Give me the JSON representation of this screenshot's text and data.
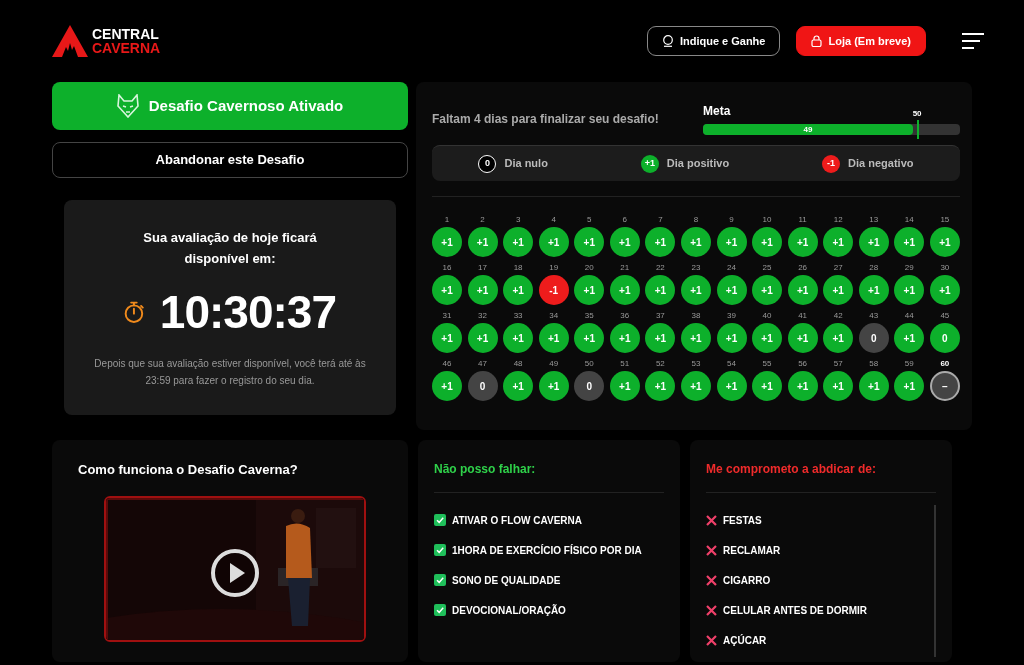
{
  "header": {
    "logo": {
      "line1": "CENTRAL",
      "line2": "CAVERNA"
    },
    "buttons": [
      {
        "kind": "outline",
        "label": "Indique e Ganhe"
      },
      {
        "kind": "solid",
        "label": "Loja (Em breve)"
      }
    ]
  },
  "challenge": {
    "active_button": "Desafio Cavernoso Ativado",
    "abandon_button": "Abandonar este Desafio"
  },
  "timer_card": {
    "title": "Sua avaliação de hoje ficará disponível em:",
    "time": "10:30:37",
    "note": "Depois que sua avaliação estiver disponível, você terá até às 23:59 para fazer o registro do seu dia."
  },
  "progress": {
    "remaining": "Faltam 4 dias para finalizar seu desafio!",
    "meta_label": "Meta",
    "goal": "50",
    "value": "49",
    "level": 0.817
  },
  "legend": [
    {
      "symbol": "0",
      "label": "Dia nulo",
      "color": "#000000"
    },
    {
      "symbol": "+1",
      "label": "Dia positivo",
      "color": "#0db02b"
    },
    {
      "symbol": "-1",
      "label": "Dia negativo",
      "color": "#ee1c1c"
    }
  ],
  "days": [
    {
      "day": "1",
      "value": "+1",
      "color": "#0db02b",
      "selected": false
    },
    {
      "day": "2",
      "value": "+1",
      "color": "#0db02b",
      "selected": false
    },
    {
      "day": "3",
      "value": "+1",
      "color": "#0db02b",
      "selected": false
    },
    {
      "day": "4",
      "value": "+1",
      "color": "#0db02b",
      "selected": false
    },
    {
      "day": "5",
      "value": "+1",
      "color": "#0db02b",
      "selected": false
    },
    {
      "day": "6",
      "value": "+1",
      "color": "#0db02b",
      "selected": false
    },
    {
      "day": "7",
      "value": "+1",
      "color": "#0db02b",
      "selected": false
    },
    {
      "day": "8",
      "value": "+1",
      "color": "#0db02b",
      "selected": false
    },
    {
      "day": "9",
      "value": "+1",
      "color": "#0db02b",
      "selected": false
    },
    {
      "day": "10",
      "value": "+1",
      "color": "#0db02b",
      "selected": false
    },
    {
      "day": "11",
      "value": "+1",
      "color": "#0db02b",
      "selected": false
    },
    {
      "day": "12",
      "value": "+1",
      "color": "#0db02b",
      "selected": false
    },
    {
      "day": "13",
      "value": "+1",
      "color": "#0db02b",
      "selected": false
    },
    {
      "day": "14",
      "value": "+1",
      "color": "#0db02b",
      "selected": false
    },
    {
      "day": "15",
      "value": "+1",
      "color": "#0db02b",
      "selected": false
    },
    {
      "day": "16",
      "value": "+1",
      "color": "#0db02b",
      "selected": false
    },
    {
      "day": "17",
      "value": "+1",
      "color": "#0db02b",
      "selected": false
    },
    {
      "day": "18",
      "value": "+1",
      "color": "#0db02b",
      "selected": false
    },
    {
      "day": "19",
      "value": "-1",
      "color": "#ee1c1c",
      "selected": false
    },
    {
      "day": "20",
      "value": "+1",
      "color": "#0db02b",
      "selected": false
    },
    {
      "day": "21",
      "value": "+1",
      "color": "#0db02b",
      "selected": false
    },
    {
      "day": "22",
      "value": "+1",
      "color": "#0db02b",
      "selected": false
    },
    {
      "day": "23",
      "value": "+1",
      "color": "#0db02b",
      "selected": false
    },
    {
      "day": "24",
      "value": "+1",
      "color": "#0db02b",
      "selected": false
    },
    {
      "day": "25",
      "value": "+1",
      "color": "#0db02b",
      "selected": false
    },
    {
      "day": "26",
      "value": "+1",
      "color": "#0db02b",
      "selected": false
    },
    {
      "day": "27",
      "value": "+1",
      "color": "#0db02b",
      "selected": false
    },
    {
      "day": "28",
      "value": "+1",
      "color": "#0db02b",
      "selected": false
    },
    {
      "day": "29",
      "value": "+1",
      "color": "#0db02b",
      "selected": false
    },
    {
      "day": "30",
      "value": "+1",
      "color": "#0db02b",
      "selected": false
    },
    {
      "day": "31",
      "value": "+1",
      "color": "#0db02b",
      "selected": false
    },
    {
      "day": "32",
      "value": "+1",
      "color": "#0db02b",
      "selected": false
    },
    {
      "day": "33",
      "value": "+1",
      "color": "#0db02b",
      "selected": false
    },
    {
      "day": "34",
      "value": "+1",
      "color": "#0db02b",
      "selected": false
    },
    {
      "day": "35",
      "value": "+1",
      "color": "#0db02b",
      "selected": false
    },
    {
      "day": "36",
      "value": "+1",
      "color": "#0db02b",
      "selected": false
    },
    {
      "day": "37",
      "value": "+1",
      "color": "#0db02b",
      "selected": false
    },
    {
      "day": "38",
      "value": "+1",
      "color": "#0db02b",
      "selected": false
    },
    {
      "day": "39",
      "value": "+1",
      "color": "#0db02b",
      "selected": false
    },
    {
      "day": "40",
      "value": "+1",
      "color": "#0db02b",
      "selected": false
    },
    {
      "day": "41",
      "value": "+1",
      "color": "#0db02b",
      "selected": false
    },
    {
      "day": "42",
      "value": "+1",
      "color": "#0db02b",
      "selected": false
    },
    {
      "day": "43",
      "value": "0",
      "color": "#444444",
      "selected": false
    },
    {
      "day": "44",
      "value": "+1",
      "color": "#0db02b",
      "selected": false
    },
    {
      "day": "45",
      "value": "0",
      "color": "#0db02b",
      "selected": false
    },
    {
      "day": "46",
      "value": "+1",
      "color": "#0db02b",
      "selected": false
    },
    {
      "day": "47",
      "value": "0",
      "color": "#444444",
      "selected": false
    },
    {
      "day": "48",
      "value": "+1",
      "color": "#0db02b",
      "selected": false
    },
    {
      "day": "49",
      "value": "+1",
      "color": "#0db02b",
      "selected": false
    },
    {
      "day": "50",
      "value": "0",
      "color": "#444444",
      "selected": false
    },
    {
      "day": "51",
      "value": "+1",
      "color": "#0db02b",
      "selected": false
    },
    {
      "day": "52",
      "value": "+1",
      "color": "#0db02b",
      "selected": false
    },
    {
      "day": "53",
      "value": "+1",
      "color": "#0db02b",
      "selected": false
    },
    {
      "day": "54",
      "value": "+1",
      "color": "#0db02b",
      "selected": false
    },
    {
      "day": "55",
      "value": "+1",
      "color": "#0db02b",
      "selected": false
    },
    {
      "day": "56",
      "value": "+1",
      "color": "#0db02b",
      "selected": false
    },
    {
      "day": "57",
      "value": "+1",
      "color": "#0db02b",
      "selected": false
    },
    {
      "day": "58",
      "value": "+1",
      "color": "#0db02b",
      "selected": false
    },
    {
      "day": "59",
      "value": "+1",
      "color": "#0db02b",
      "selected": false
    },
    {
      "day": "60",
      "value": "–",
      "color": "#444444",
      "selected": true
    }
  ],
  "video_card": {
    "title": "Como funciona o Desafio Caverna?"
  },
  "must_do": {
    "title": "Não posso falhar:",
    "items": [
      {
        "label": "ATIVAR O FLOW CAVERNA",
        "checked": true
      },
      {
        "label": "1HORA DE EXERCÍCIO FÍSICO POR DIA",
        "checked": true
      },
      {
        "label": "SONO DE QUALIDADE",
        "checked": true
      },
      {
        "label": "DEVOCIONAL/ORAÇÃO",
        "checked": true
      }
    ]
  },
  "give_up": {
    "title": "Me comprometo a abdicar de:",
    "items": [
      "FESTAS",
      "RECLAMAR",
      "CIGARRO",
      "CELULAR ANTES DE DORMIR",
      "AÇÚCAR"
    ]
  }
}
